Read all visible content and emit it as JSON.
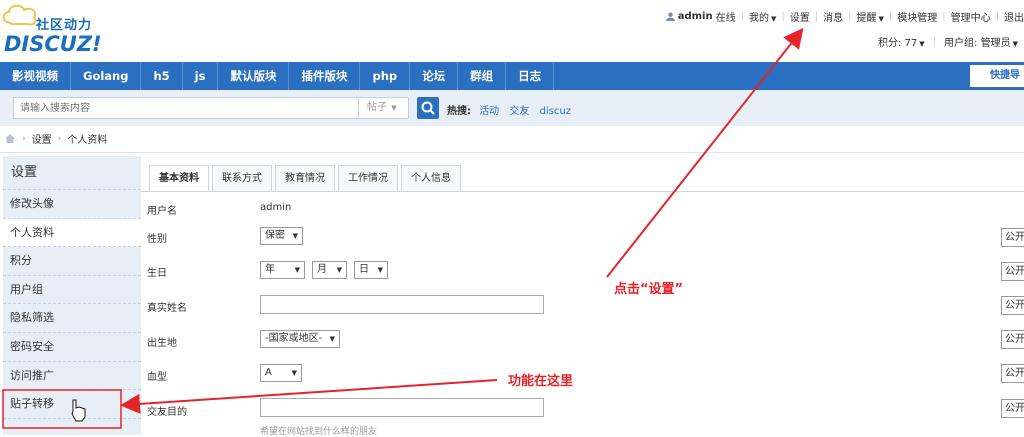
{
  "logo": {
    "cn": "社区动力",
    "en": "DISCUZ!"
  },
  "topnav": {
    "username": "admin",
    "online": "在线",
    "links": [
      "我的",
      "设置",
      "消息",
      "提醒",
      "模块管理",
      "管理中心",
      "退出"
    ]
  },
  "subnav": {
    "points": "积分: 77",
    "usergroup": "用户组: 管理员"
  },
  "nav": {
    "items": [
      "影视视频",
      "Golang",
      "h5",
      "js",
      "默认版块",
      "插件版块",
      "php",
      "论坛",
      "群组",
      "日志"
    ],
    "quick": "快捷导"
  },
  "search": {
    "placeholder": "请输入搜索内容",
    "type": "帖子",
    "hot_label": "热搜:",
    "hot_links": [
      "活动",
      "交友",
      "discuz"
    ]
  },
  "breadcrumb": [
    "设置",
    "个人资料"
  ],
  "sidebar": {
    "title": "设置",
    "items": [
      "修改头像",
      "个人资料",
      "积分",
      "用户组",
      "隐私筛选",
      "密码安全",
      "访问推广",
      "贴子转移"
    ]
  },
  "tabs": [
    "基本资料",
    "联系方式",
    "教育情况",
    "工作情况",
    "个人信息"
  ],
  "form": {
    "username_label": "用户名",
    "username_value": "admin",
    "gender_label": "性别",
    "gender_value": "保密",
    "birthday_label": "生日",
    "year": "年",
    "month": "月",
    "day": "日",
    "realname_label": "真实姓名",
    "birthplace_label": "出生地",
    "birthplace_value": "-国家或地区-",
    "blood_label": "血型",
    "blood_value": "A",
    "purpose_label": "交友目的",
    "purpose_hint": "希望在网站找到什么样的朋友",
    "privacy": "公开"
  },
  "annotations": {
    "click_settings": "点击“设置”",
    "feature_here": "功能在这里"
  },
  "colors": {
    "brand": "#2a6fc0",
    "annotation": "#e5242a"
  }
}
